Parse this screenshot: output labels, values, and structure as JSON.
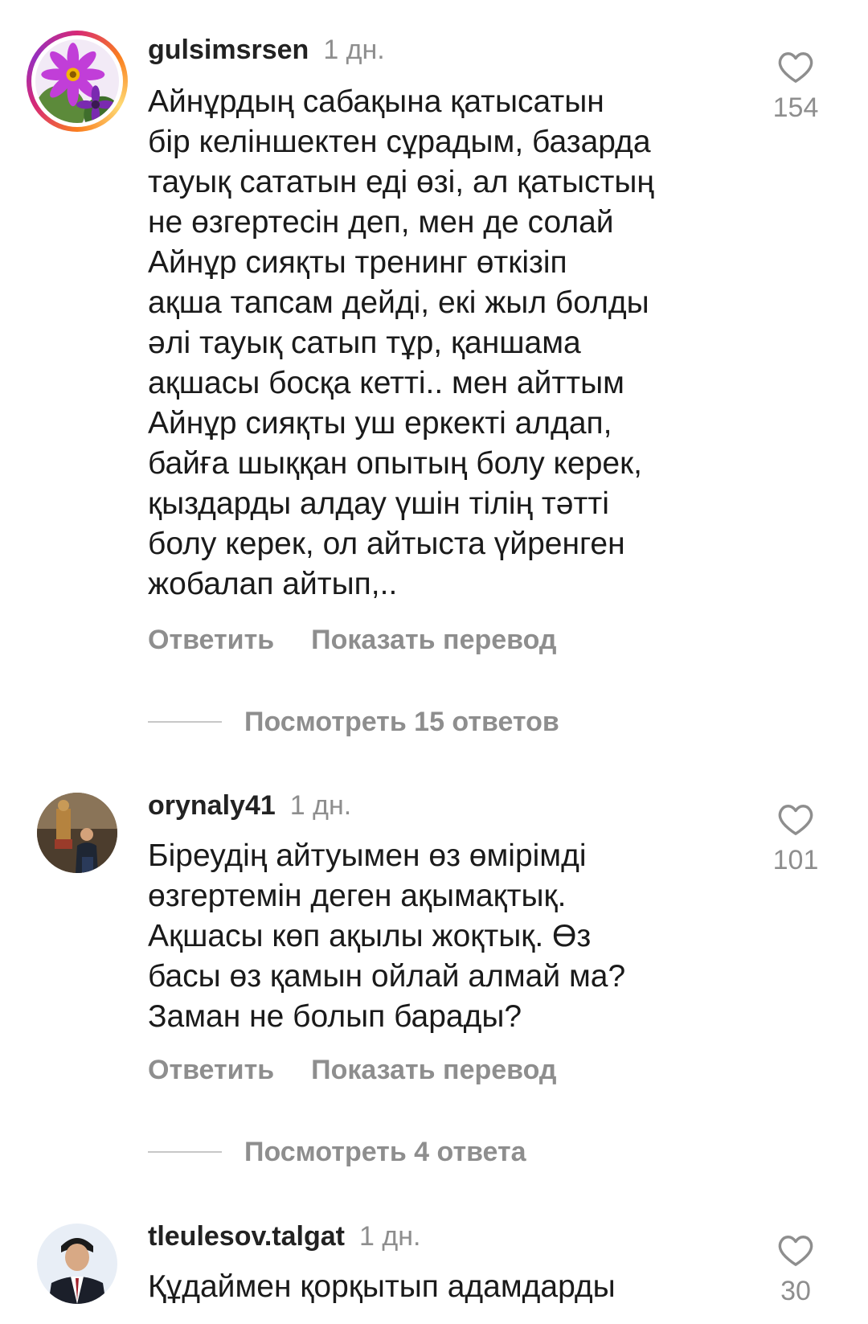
{
  "comments": [
    {
      "username": "gulsimsrsen",
      "time": "1 дн.",
      "text_lines": [
        "Айнұрдың сабақына қатысатын",
        "бір келіншектен сұрадым, базарда",
        "тауық сататын еді өзі, ал қатыстың",
        "не өзгертесін деп, мен де солай",
        "Айнұр сияқты тренинг өткізіп",
        "ақша тапсам дейді, екі жыл болды",
        "әлі тауық сатып тұр, қаншама",
        "ақшасы босқа кетті.. мен айттым",
        "Айнұр сияқты уш еркекті алдап,",
        "байға шыққан опытың болу керек,",
        "қыздарды алдау үшін тілің тәтті",
        "болу керек, ол айтыста үйренген",
        "жобалап айтып,.."
      ],
      "reply_label": "Ответить",
      "translate_label": "Показать перевод",
      "view_replies": "Посмотреть 15 ответов",
      "likes": "154"
    },
    {
      "username": "orynaly41",
      "time": "1 дн.",
      "text_lines": [
        "Біреудің айтуымен өз өмірімді",
        "өзгертемін деген ақымақтық.",
        "Ақшасы көп ақылы жоқтық. Өз",
        "басы өз қамын ойлай алмай ма?",
        "Заман не болып барады?"
      ],
      "reply_label": "Ответить",
      "translate_label": "Показать перевод",
      "view_replies": "Посмотреть 4 ответа",
      "likes": "101"
    },
    {
      "username": "tleulesov.talgat",
      "time": "1 дн.",
      "text_lines": [
        "Құдаймен қорқытып адамдарды"
      ],
      "likes": "30"
    }
  ],
  "colors": {
    "username": "#222222",
    "secondary": "#8e8e8e",
    "text": "#1a1a1a",
    "story_ring": [
      "#d62976",
      "#fa7e1e",
      "#feda75",
      "#962fbf"
    ]
  },
  "icons": {
    "like": "heart-outline-icon"
  }
}
